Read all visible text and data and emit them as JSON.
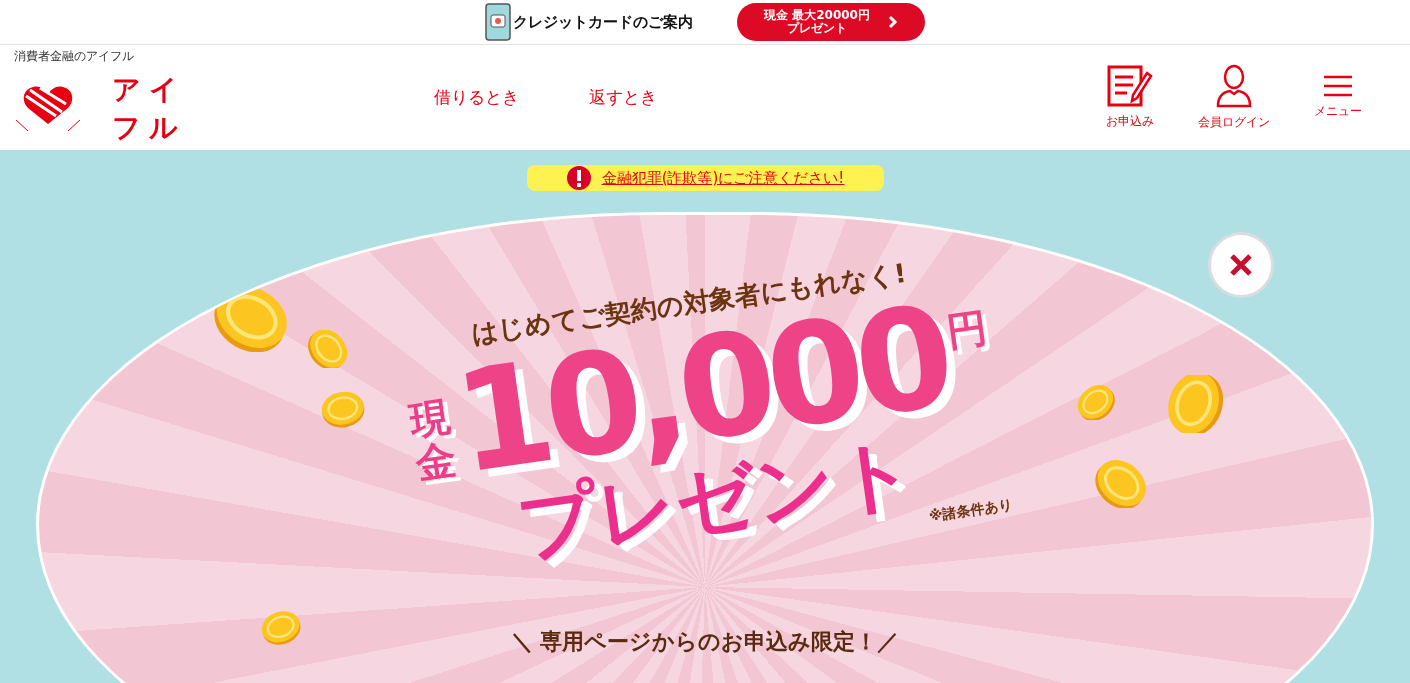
{
  "top_bar": {
    "card_link": "クレジットカードのご案内",
    "promo_button": {
      "line1": "現金 最大20000円",
      "line2": "プレゼント"
    }
  },
  "header": {
    "tagline": "消費者金融のアイフル",
    "logo_text": "アイフル",
    "nav": [
      "借りるとき",
      "返すとき"
    ],
    "actions": [
      {
        "kind": "apply",
        "label": "お申込み"
      },
      {
        "kind": "login",
        "label": "会員ログイン"
      },
      {
        "kind": "menu",
        "label": "メニュー"
      }
    ]
  },
  "notice": {
    "text": "金融犯罪(詐欺等)にご注意ください!"
  },
  "banner": {
    "headline": "はじめてご契約の対象者にもれなく!",
    "cash": "現金",
    "amount": "10,000",
    "unit": "円",
    "present": "プレゼント",
    "note": "※諸条件あり",
    "footer": "＼ 専用ページからのお申込み限定！／"
  }
}
